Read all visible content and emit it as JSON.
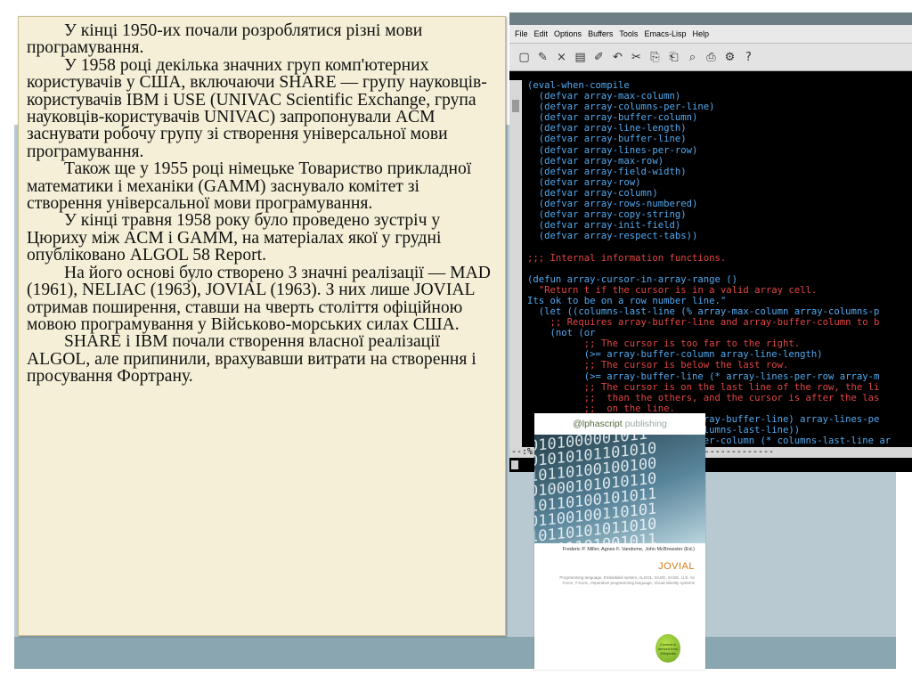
{
  "slide": {
    "paragraphs": [
      "У кінці 1950-их почали розроблятися різні мови програмування.",
      "У 1958 році декілька значних груп комп'ютерних користувачів у США, включаючи SHARE — групу науковців-користувачів IBM і USE (UNIVAC Scientific Exchange, група науковців-користувачів UNIVAC) запропонували ACM заснувати робочу групу зі створення універсальної мови програмування.",
      "Також ще у 1955 році німецьке Товариство прикладної математики і механіки (GAMM) заснувало комітет зі створення універсальної мови програмування.",
      "У кінці травня 1958 року було проведено зустріч у Цюриху між ACM і GAMM, на матеріалах якої у грудні опубліковано ALGOL 58 Report.",
      "На його основі було створено 3 значні реалізації — MAD (1961), NELIAC (1963), JOVIAL (1963). З них лише JOVIAL отримав поширення, ставши на чверть століття офіційною мовою програмування у Військово-морських силах США.",
      "SHARE і IBM почали створення власної реалізації ALGOL, але припинили, врахувавши витрати на створення і просування Фортрану."
    ]
  },
  "emacs": {
    "menu": [
      "File",
      "Edit",
      "Options",
      "Buffers",
      "Tools",
      "Emacs-Lisp",
      "Help"
    ],
    "toolbar_icons": [
      "new-file-icon",
      "open-icon",
      "close-icon",
      "save-icon",
      "save-as-icon",
      "undo-icon",
      "cut-icon",
      "copy-icon",
      "paste-icon",
      "search-icon",
      "print-icon",
      "preferences-icon",
      "help-icon"
    ],
    "toolbar_glyphs": [
      "▢",
      "✎",
      "×",
      "▤",
      "✐",
      "↶",
      "✂",
      "⎘",
      "⎗",
      "⌕",
      "⎙",
      "⚙",
      "?"
    ],
    "code_lines": [
      {
        "text": "(eval-when-compile",
        "type": "code"
      },
      {
        "text": "  (defvar array-max-column)",
        "type": "code"
      },
      {
        "text": "  (defvar array-columns-per-line)",
        "type": "code"
      },
      {
        "text": "  (defvar array-buffer-column)",
        "type": "code"
      },
      {
        "text": "  (defvar array-line-length)",
        "type": "code"
      },
      {
        "text": "  (defvar array-buffer-line)",
        "type": "code"
      },
      {
        "text": "  (defvar array-lines-per-row)",
        "type": "code"
      },
      {
        "text": "  (defvar array-max-row)",
        "type": "code"
      },
      {
        "text": "  (defvar array-field-width)",
        "type": "code"
      },
      {
        "text": "  (defvar array-row)",
        "type": "code"
      },
      {
        "text": "  (defvar array-column)",
        "type": "code"
      },
      {
        "text": "  (defvar array-rows-numbered)",
        "type": "code"
      },
      {
        "text": "  (defvar array-copy-string)",
        "type": "code"
      },
      {
        "text": "  (defvar array-init-field)",
        "type": "code"
      },
      {
        "text": "  (defvar array-respect-tabs))",
        "type": "code"
      },
      {
        "text": "",
        "type": "code"
      },
      {
        "text": ";;; Internal information functions.",
        "type": "comment"
      },
      {
        "text": "",
        "type": "code"
      },
      {
        "text": "(defun array-cursor-in-array-range ()",
        "type": "code"
      },
      {
        "text": "  \"Return t if the cursor is in a valid array cell.",
        "type": "comment"
      },
      {
        "text": "Its ok to be on a row number line.\"",
        "type": "code"
      },
      {
        "text": "  (let ((columns-last-line (% array-max-column array-columns-p",
        "type": "code"
      },
      {
        "text": "    ;; Requires array-buffer-line and array-buffer-column to b",
        "type": "comment"
      },
      {
        "text": "    (not (or",
        "type": "code"
      },
      {
        "text": "          ;; The cursor is too far to the right.",
        "type": "comment"
      },
      {
        "text": "          (>= array-buffer-column array-line-length)",
        "type": "code"
      },
      {
        "text": "          ;; The cursor is below the last row.",
        "type": "comment"
      },
      {
        "text": "          (>= array-buffer-line (* array-lines-per-row array-m",
        "type": "code"
      },
      {
        "text": "          ;; The cursor is on the last line of the row, the li",
        "type": "comment"
      },
      {
        "text": "          ;;  than the others, and the cursor is after the las",
        "type": "comment"
      },
      {
        "text": "          ;;  on the line.",
        "type": "comment"
      },
      {
        "text": "          (and (zerop (% (1+ array-buffer-line) array-lines-pe",
        "type": "code"
      },
      {
        "text": "                              olumns-last-line))",
        "type": "code"
      },
      {
        "text": "                              fer-column (* columns-last-line ar",
        "type": "code"
      }
    ],
    "prompt_char": "e)",
    "modeline": "--:%              Lisp)--L61-- 5%----------------"
  },
  "book": {
    "publisher_brand": "@lphascript",
    "publisher_word": "publishing",
    "binary_lines": [
      "0101000001011",
      "01010101101010",
      "10110100100100",
      "01000101010110",
      "10110100101011",
      "01100100110101",
      "10110101011010",
      "01011101001011"
    ],
    "authors": "Frederic P. Miller, Agnes F. Vandome, John McBrewster (Ed.)",
    "title": "JOVIAL",
    "description": "Programming language, Embedded system, ALGOL, SAGE, SAGE, U.S. Air Force, Y-GJAL, Imperative programming language, Visual Identity systems",
    "badge": "Content is derived from Wikipedia"
  }
}
